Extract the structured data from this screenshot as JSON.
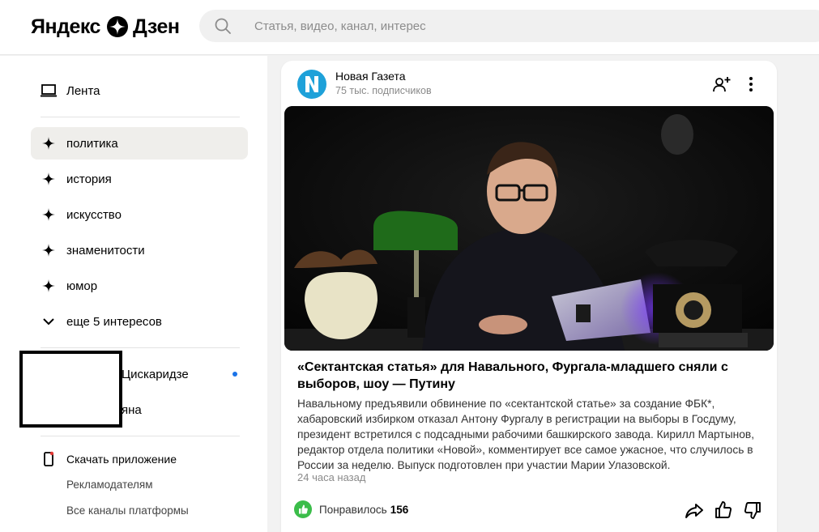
{
  "header": {
    "logo_left": "Яндекс",
    "logo_right": "Дзен",
    "search_placeholder": "Статья, видео, канал, интерес"
  },
  "sidebar": {
    "feed_label": "Лента",
    "interests": [
      {
        "label": "политика",
        "active": true
      },
      {
        "label": "история"
      },
      {
        "label": "искусство"
      },
      {
        "label": "знаменитости"
      },
      {
        "label": "юмор"
      }
    ],
    "more_interests": "еще 5 интересов",
    "subscriptions": [
      {
        "label": "Цискаридзе",
        "unread": true
      },
      {
        "label": "яна"
      }
    ],
    "download_app": "Скачать приложение",
    "advertisers": "Рекламодателям",
    "all_channels": "Все каналы платформы"
  },
  "card": {
    "channel_name": "Новая Газета",
    "subscribers": "75 тыс. подписчиков",
    "title": "«Сектантская статья» для Навального, Фургала-младшего сняли с выборов, шоу — Путину",
    "text": "Навальному предъявили обвинение по «сектантской статье» за создание ФБК*, хабаровский избирком отказал Антону Фургалу в регистрации на выборы в Госдуму, президент встретился с подсадными рабочими башкирского завода. Кирилл Мартынов, редактор отдела политики «Новой», комментирует все самое ужасное, что случилось в России за неделю. Выпуск подготовлен при участии Марии Улазовской.",
    "time": "24 часа назад",
    "like_label": "Понравилось",
    "like_count": "156"
  },
  "colors": {
    "accent_green": "#3bbd4a",
    "channel_blue": "#1ea1d9",
    "dot_blue": "#1a73e8",
    "active_bg": "#efeeeb"
  }
}
